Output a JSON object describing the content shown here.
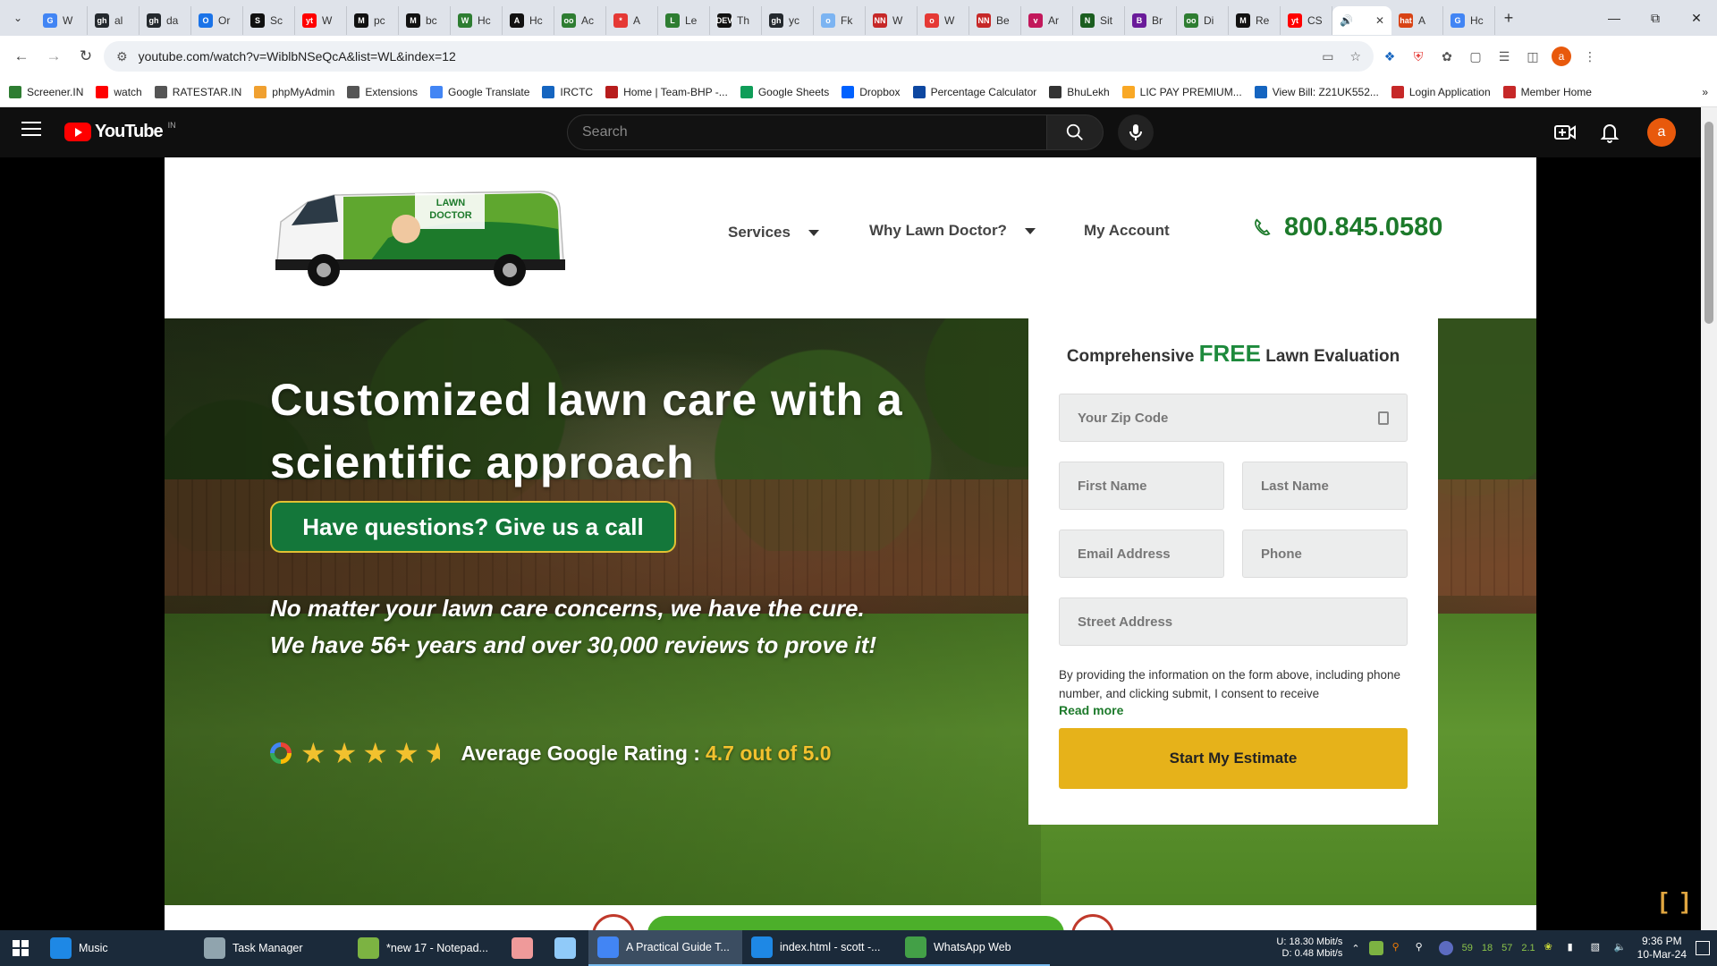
{
  "browser": {
    "tabs": [
      {
        "label": "W",
        "favicon": "G",
        "color": "#4285f4"
      },
      {
        "label": "al",
        "favicon": "gh",
        "color": "#24292e"
      },
      {
        "label": "da",
        "favicon": "gh",
        "color": "#24292e"
      },
      {
        "label": "Or",
        "favicon": "O",
        "color": "#1a73e8"
      },
      {
        "label": "Sc",
        "favicon": "S",
        "color": "#111111"
      },
      {
        "label": "W",
        "favicon": "yt",
        "color": "#ff0000"
      },
      {
        "label": "pc",
        "favicon": "M",
        "color": "#111111"
      },
      {
        "label": "bc",
        "favicon": "M",
        "color": "#111111"
      },
      {
        "label": "Hc",
        "favicon": "W",
        "color": "#2e7d32"
      },
      {
        "label": "Hc",
        "favicon": "A",
        "color": "#111111"
      },
      {
        "label": "Ac",
        "favicon": "oo",
        "color": "#2e7d32"
      },
      {
        "label": "A",
        "favicon": "*",
        "color": "#e53935"
      },
      {
        "label": "Le",
        "favicon": "L",
        "color": "#2e7d32"
      },
      {
        "label": "Th",
        "favicon": "DEV",
        "color": "#111111"
      },
      {
        "label": "yc",
        "favicon": "gh",
        "color": "#24292e"
      },
      {
        "label": "Fk",
        "favicon": "o",
        "color": "#7cb4f2"
      },
      {
        "label": "W",
        "favicon": "NN",
        "color": "#c62828"
      },
      {
        "label": "W",
        "favicon": "o",
        "color": "#e53935"
      },
      {
        "label": "Be",
        "favicon": "NN",
        "color": "#c62828"
      },
      {
        "label": "Ar",
        "favicon": "v",
        "color": "#c2185b"
      },
      {
        "label": "Sit",
        "favicon": "N",
        "color": "#1b5e20"
      },
      {
        "label": "Br",
        "favicon": "B",
        "color": "#6a1b9a"
      },
      {
        "label": "Di",
        "favicon": "oo",
        "color": "#2e7d32"
      },
      {
        "label": "Re",
        "favicon": "M",
        "color": "#111111"
      },
      {
        "label": "CS",
        "favicon": "yt",
        "color": "#ff0000"
      }
    ],
    "active_tab": {
      "label": "",
      "favicon": "sound"
    },
    "after_tabs": [
      {
        "label": "A",
        "favicon": "hat",
        "color": "#d84315"
      },
      {
        "label": "Hc",
        "favicon": "G",
        "color": "#4285f4"
      }
    ],
    "url": "youtube.com/watch?v=WiblbNSeQcA&list=WL&index=12",
    "profile_initial": "a",
    "bookmarks": [
      {
        "label": "Screener.IN",
        "color": "#2e7d32"
      },
      {
        "label": "watch",
        "color": "#ff0000"
      },
      {
        "label": "RATESTAR.IN",
        "color": "#555555"
      },
      {
        "label": "phpMyAdmin",
        "color": "#f0a030"
      },
      {
        "label": "Extensions",
        "color": "#555555"
      },
      {
        "label": "Google Translate",
        "color": "#4285f4"
      },
      {
        "label": "IRCTC",
        "color": "#1565c0"
      },
      {
        "label": "Home | Team-BHP -...",
        "color": "#b71c1c"
      },
      {
        "label": "Google Sheets",
        "color": "#0f9d58"
      },
      {
        "label": "Dropbox",
        "color": "#0061ff"
      },
      {
        "label": "Percentage Calculator",
        "color": "#0d47a1"
      },
      {
        "label": "BhuLekh",
        "color": "#333333"
      },
      {
        "label": "LIC PAY PREMIUM...",
        "color": "#f9a825"
      },
      {
        "label": "View Bill: Z21UK552...",
        "color": "#1565c0"
      },
      {
        "label": "Login Application",
        "color": "#c62828"
      },
      {
        "label": "Member Home",
        "color": "#c62828"
      }
    ]
  },
  "youtube": {
    "logo_word": "YouTube",
    "region": "IN",
    "search_placeholder": "Search",
    "avatar_initial": "a"
  },
  "site": {
    "nav": {
      "services": "Services",
      "why": "Why Lawn Doctor?",
      "account": "My Account",
      "phone": "800.845.0580"
    },
    "hero": {
      "title": "Customized lawn care with a scientific approach",
      "call_button": "Have questions? Give us a call",
      "subtitle": "No matter your lawn care concerns, we have the cure. We have 56+ years and over 30,000 reviews to prove it!",
      "rating_label": "Average Google Rating :",
      "rating_value": "4.7 out of 5.0",
      "stars": 4.7
    },
    "form": {
      "title_before": "Comprehensive",
      "title_free": "FREE",
      "title_after": "Lawn Evaluation",
      "zip_placeholder": "Your Zip Code",
      "first_name_placeholder": "First Name",
      "last_name_placeholder": "Last Name",
      "email_placeholder": "Email Address",
      "phone_placeholder": "Phone",
      "street_placeholder": "Street Address",
      "consent": "By providing the information on the form above, including phone number, and clicking submit, I consent to receive",
      "read_more": "Read more",
      "submit": "Start My Estimate"
    }
  },
  "taskbar": {
    "items": [
      {
        "label": "Music",
        "color": "#1e88e5"
      },
      {
        "label": "Task Manager",
        "color": "#90a4ae"
      },
      {
        "label": "*new 17 - Notepad...",
        "color": "#7cb342"
      },
      {
        "label": "",
        "color": "#ef9a9a"
      },
      {
        "label": "",
        "color": "#90caf9"
      },
      {
        "label": "A Practical Guide T...",
        "color": "#4285f4"
      },
      {
        "label": "index.html - scott -...",
        "color": "#1e88e5"
      },
      {
        "label": "WhatsApp Web",
        "color": "#43a047"
      }
    ],
    "net_up": "18.30 Mbit/s",
    "net_down": "0.48 Mbit/s",
    "net_up_label": "U:",
    "net_down_label": "D:",
    "tray_numbers": [
      "59",
      "18",
      "57",
      "2.1"
    ],
    "time": "9:36 PM",
    "date": "10-Mar-24"
  }
}
